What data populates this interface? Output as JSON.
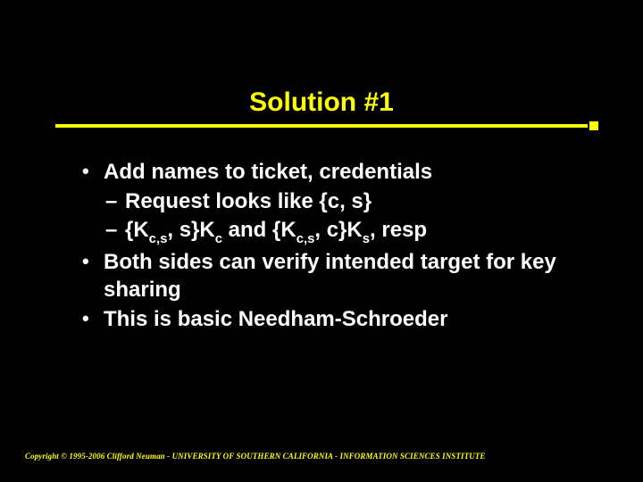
{
  "title": "Solution #1",
  "bullets": {
    "b1": "Add names to ticket, credentials",
    "b1a": "Request looks like {c, s}",
    "b1b_pre": "{K",
    "b1b_sub1": "c,s",
    "b1b_mid1": ", s}K",
    "b1b_sub2": "c",
    "b1b_mid2": " and {K",
    "b1b_sub3": "c,s",
    "b1b_mid3": ", c}K",
    "b1b_sub4": "s",
    "b1b_end": ", resp",
    "b2": "Both sides can verify intended target for key sharing",
    "b3": "This is basic Needham-Schroeder"
  },
  "footer": "Copyright © 1995-2006 Clifford Neuman - UNIVERSITY OF SOUTHERN CALIFORNIA - INFORMATION SCIENCES INSTITUTE"
}
